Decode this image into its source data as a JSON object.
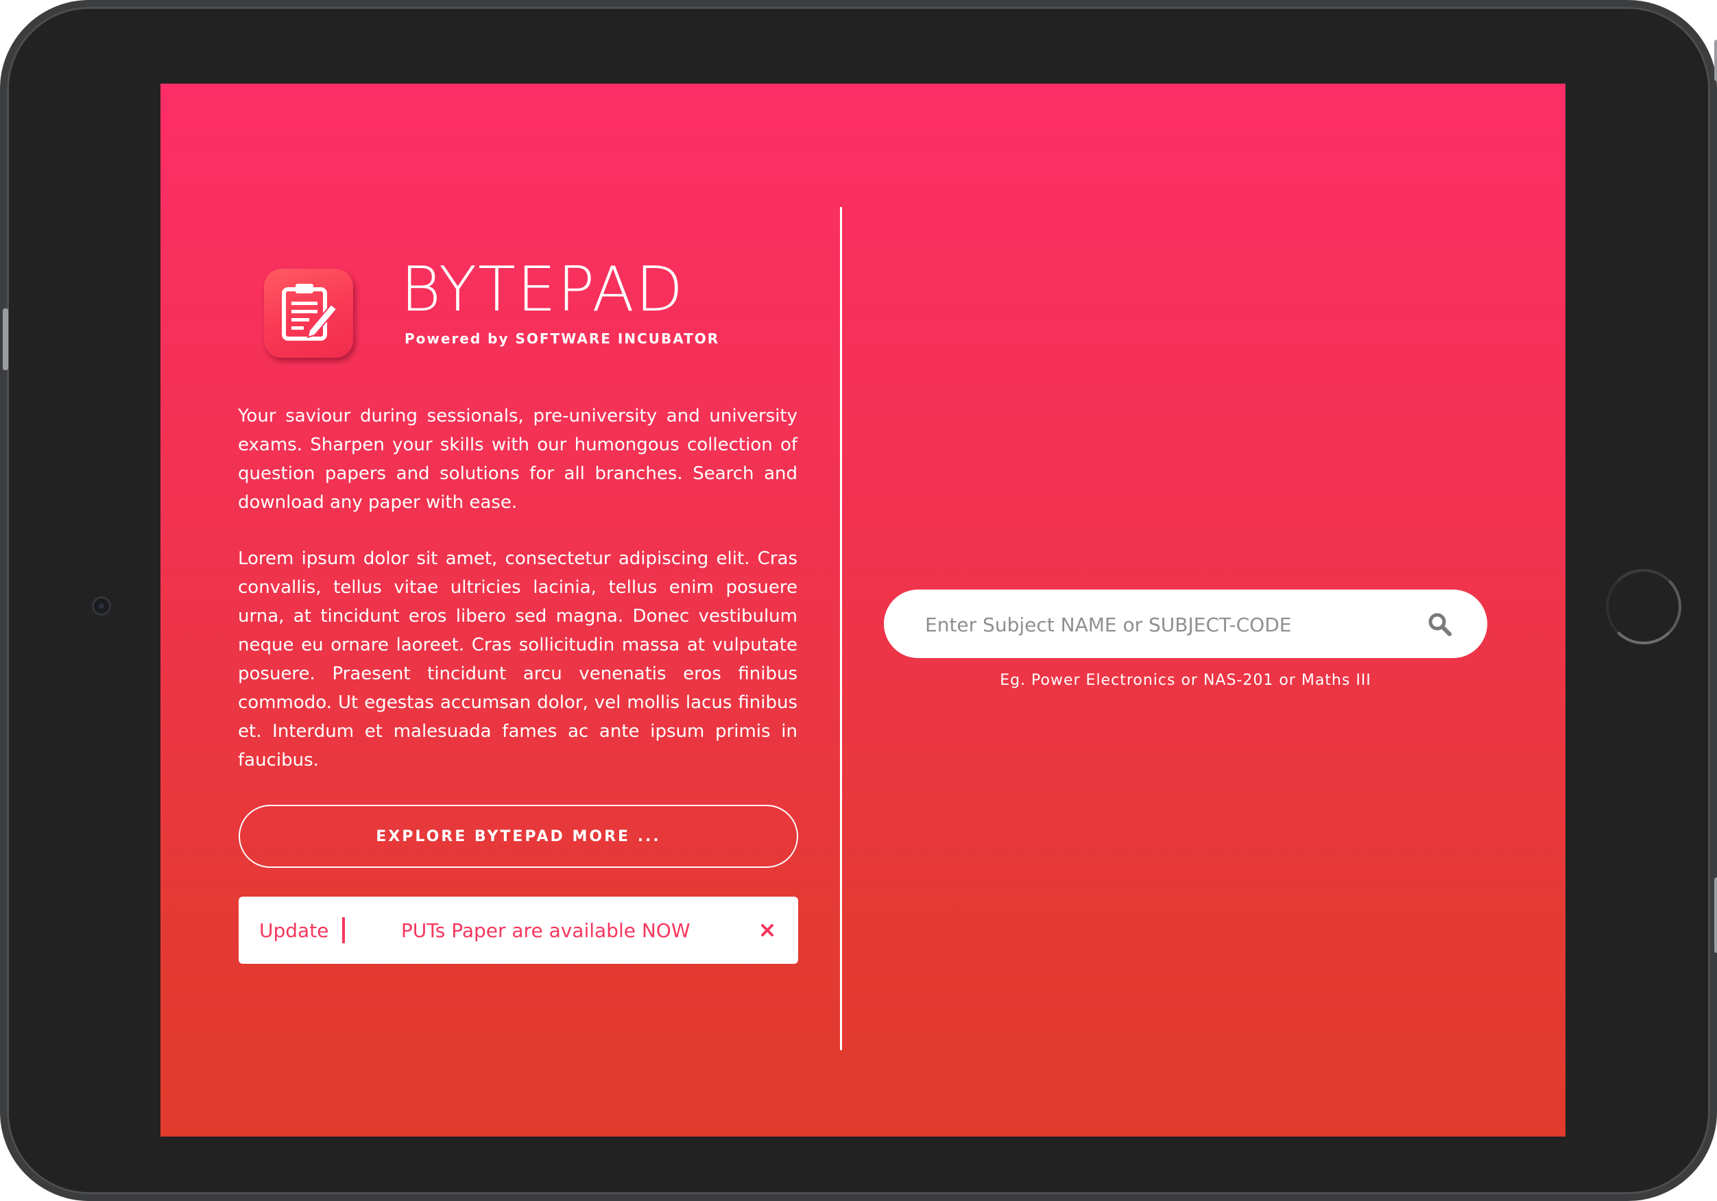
{
  "app": {
    "title": "BYTEPAD",
    "subtitle_prefix": "Powered by",
    "subtitle_org": "SOFTWARE INCUBATOR",
    "icon": "clipboard-edit-icon"
  },
  "intro": {
    "paragraph_1": "Your saviour during sessionals, pre-university and university exams. Sharpen your skills with our humongous collection of question papers and solutions for all branches. Search and download any paper with ease.",
    "paragraph_2": "Lorem ipsum dolor sit amet, consectetur adipiscing elit. Cras convallis, tellus vitae ultricies lacinia, tellus enim posuere urna, at tincidunt eros libero sed magna. Donec vestibulum neque eu ornare laoreet. Cras sollicitudin massa at vulputate posuere. Praesent tincidunt arcu venenatis eros finibus commodo. Ut egestas accumsan dolor, vel mollis lacus finibus et. Interdum et malesuada fames ac ante ipsum primis in faucibus."
  },
  "explore_button": {
    "label": "EXPLORE BYTEPAD MORE ..."
  },
  "update_bar": {
    "label": "Update",
    "message": "PUTs Paper are available NOW",
    "close_icon": "close-icon"
  },
  "search": {
    "value": "",
    "placeholder": "Enter Subject NAME or SUBJECT-CODE",
    "hint": "Eg. Power Electronics or NAS-201 or Maths III",
    "icon": "search-icon"
  },
  "colors": {
    "gradient_top": "#fd2e67",
    "gradient_bottom": "#e03b2d",
    "accent": "#f5375e",
    "device_frame": "#222223"
  }
}
